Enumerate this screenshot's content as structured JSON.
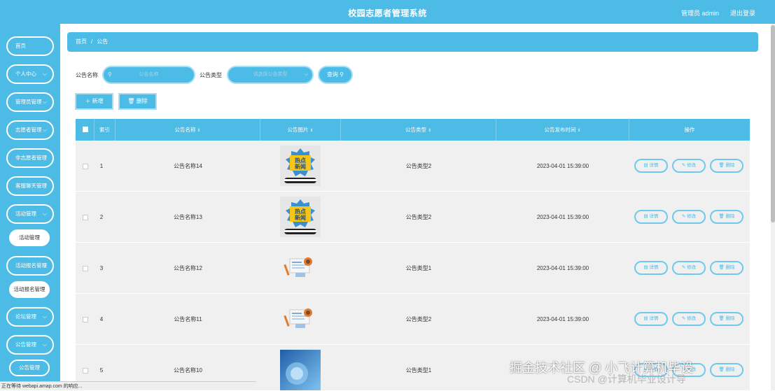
{
  "header": {
    "title": "校园志愿者管理系统",
    "user": "管理员 admin",
    "logout": "退出登录"
  },
  "sidebar": {
    "items": [
      {
        "label": "首页",
        "chevron": false
      },
      {
        "label": "个人中心",
        "chevron": true
      },
      {
        "label": "管理员管理",
        "chevron": true
      },
      {
        "label": "志愿者管理",
        "chevron": true
      },
      {
        "label": "非志愿者管理",
        "chevron": false
      },
      {
        "label": "客服聊天管理",
        "chevron": false
      },
      {
        "label": "活动管理",
        "chevron": true
      },
      {
        "label": "活动管理",
        "sub": true
      },
      {
        "label": "活动报名管理",
        "chevron": true
      },
      {
        "label": "活动报名管理",
        "sub": true
      },
      {
        "label": "论坛管理",
        "chevron": true
      },
      {
        "label": "公告管理",
        "chevron": true
      },
      {
        "label": "公告管理",
        "sub": true
      }
    ]
  },
  "breadcrumb": {
    "home": "首页",
    "sep": "/",
    "current": "公告"
  },
  "search": {
    "name_label": "公告名称",
    "name_placeholder": "公告名称",
    "type_label": "公告类型",
    "type_placeholder": "请选择公告类型",
    "query_button": "查询"
  },
  "actions": {
    "add": "新增",
    "delete": "删除"
  },
  "table": {
    "headers": [
      "索引",
      "公告名称",
      "公告图片",
      "公告类型",
      "公告发布时间",
      "操作"
    ],
    "rows": [
      {
        "index": "1",
        "name": "公告名称14",
        "type": "公告类型2",
        "time": "2023-04-01 15:39:00",
        "image": "hot-news"
      },
      {
        "index": "2",
        "name": "公告名称13",
        "type": "公告类型2",
        "time": "2023-04-01 15:39:00",
        "image": "hot-news"
      },
      {
        "index": "3",
        "name": "公告名称12",
        "type": "公告类型1",
        "time": "2023-04-01 15:39:00",
        "image": "newspaper"
      },
      {
        "index": "4",
        "name": "公告名称11",
        "type": "公告类型2",
        "time": "2023-04-01 15:39:00",
        "image": "newspaper"
      },
      {
        "index": "5",
        "name": "公告名称10",
        "type": "公告类型1",
        "time": "",
        "image": "blue-news"
      }
    ],
    "ops": {
      "detail": "详情",
      "edit": "修改",
      "delete": "删除"
    }
  },
  "status_bar": "正在等待 webapi.amap.com 的响应...",
  "watermark": {
    "line1": "掘金技术社区 @ 小飞计算机毕设",
    "line2": "CSDN @计算机毕业设计导"
  },
  "colors": {
    "primary": "#4cbbe6",
    "row_bg": "#f0f0f0"
  }
}
